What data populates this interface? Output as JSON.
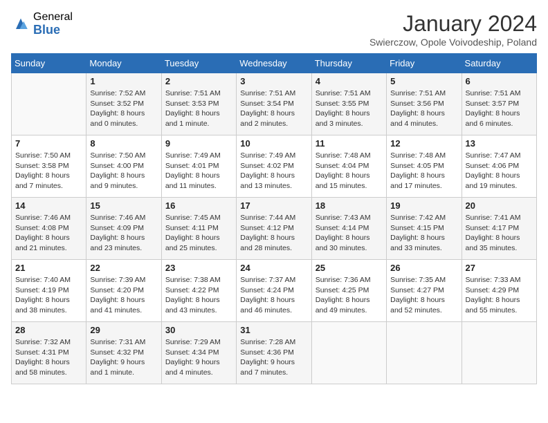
{
  "logo": {
    "general": "General",
    "blue": "Blue"
  },
  "title": {
    "month_year": "January 2024",
    "location": "Swierczow, Opole Voivodeship, Poland"
  },
  "days_of_week": [
    "Sunday",
    "Monday",
    "Tuesday",
    "Wednesday",
    "Thursday",
    "Friday",
    "Saturday"
  ],
  "weeks": [
    [
      {
        "day": "",
        "info": ""
      },
      {
        "day": "1",
        "info": "Sunrise: 7:52 AM\nSunset: 3:52 PM\nDaylight: 8 hours\nand 0 minutes."
      },
      {
        "day": "2",
        "info": "Sunrise: 7:51 AM\nSunset: 3:53 PM\nDaylight: 8 hours\nand 1 minute."
      },
      {
        "day": "3",
        "info": "Sunrise: 7:51 AM\nSunset: 3:54 PM\nDaylight: 8 hours\nand 2 minutes."
      },
      {
        "day": "4",
        "info": "Sunrise: 7:51 AM\nSunset: 3:55 PM\nDaylight: 8 hours\nand 3 minutes."
      },
      {
        "day": "5",
        "info": "Sunrise: 7:51 AM\nSunset: 3:56 PM\nDaylight: 8 hours\nand 4 minutes."
      },
      {
        "day": "6",
        "info": "Sunrise: 7:51 AM\nSunset: 3:57 PM\nDaylight: 8 hours\nand 6 minutes."
      }
    ],
    [
      {
        "day": "7",
        "info": "Sunrise: 7:50 AM\nSunset: 3:58 PM\nDaylight: 8 hours\nand 7 minutes."
      },
      {
        "day": "8",
        "info": "Sunrise: 7:50 AM\nSunset: 4:00 PM\nDaylight: 8 hours\nand 9 minutes."
      },
      {
        "day": "9",
        "info": "Sunrise: 7:49 AM\nSunset: 4:01 PM\nDaylight: 8 hours\nand 11 minutes."
      },
      {
        "day": "10",
        "info": "Sunrise: 7:49 AM\nSunset: 4:02 PM\nDaylight: 8 hours\nand 13 minutes."
      },
      {
        "day": "11",
        "info": "Sunrise: 7:48 AM\nSunset: 4:04 PM\nDaylight: 8 hours\nand 15 minutes."
      },
      {
        "day": "12",
        "info": "Sunrise: 7:48 AM\nSunset: 4:05 PM\nDaylight: 8 hours\nand 17 minutes."
      },
      {
        "day": "13",
        "info": "Sunrise: 7:47 AM\nSunset: 4:06 PM\nDaylight: 8 hours\nand 19 minutes."
      }
    ],
    [
      {
        "day": "14",
        "info": "Sunrise: 7:46 AM\nSunset: 4:08 PM\nDaylight: 8 hours\nand 21 minutes."
      },
      {
        "day": "15",
        "info": "Sunrise: 7:46 AM\nSunset: 4:09 PM\nDaylight: 8 hours\nand 23 minutes."
      },
      {
        "day": "16",
        "info": "Sunrise: 7:45 AM\nSunset: 4:11 PM\nDaylight: 8 hours\nand 25 minutes."
      },
      {
        "day": "17",
        "info": "Sunrise: 7:44 AM\nSunset: 4:12 PM\nDaylight: 8 hours\nand 28 minutes."
      },
      {
        "day": "18",
        "info": "Sunrise: 7:43 AM\nSunset: 4:14 PM\nDaylight: 8 hours\nand 30 minutes."
      },
      {
        "day": "19",
        "info": "Sunrise: 7:42 AM\nSunset: 4:15 PM\nDaylight: 8 hours\nand 33 minutes."
      },
      {
        "day": "20",
        "info": "Sunrise: 7:41 AM\nSunset: 4:17 PM\nDaylight: 8 hours\nand 35 minutes."
      }
    ],
    [
      {
        "day": "21",
        "info": "Sunrise: 7:40 AM\nSunset: 4:19 PM\nDaylight: 8 hours\nand 38 minutes."
      },
      {
        "day": "22",
        "info": "Sunrise: 7:39 AM\nSunset: 4:20 PM\nDaylight: 8 hours\nand 41 minutes."
      },
      {
        "day": "23",
        "info": "Sunrise: 7:38 AM\nSunset: 4:22 PM\nDaylight: 8 hours\nand 43 minutes."
      },
      {
        "day": "24",
        "info": "Sunrise: 7:37 AM\nSunset: 4:24 PM\nDaylight: 8 hours\nand 46 minutes."
      },
      {
        "day": "25",
        "info": "Sunrise: 7:36 AM\nSunset: 4:25 PM\nDaylight: 8 hours\nand 49 minutes."
      },
      {
        "day": "26",
        "info": "Sunrise: 7:35 AM\nSunset: 4:27 PM\nDaylight: 8 hours\nand 52 minutes."
      },
      {
        "day": "27",
        "info": "Sunrise: 7:33 AM\nSunset: 4:29 PM\nDaylight: 8 hours\nand 55 minutes."
      }
    ],
    [
      {
        "day": "28",
        "info": "Sunrise: 7:32 AM\nSunset: 4:31 PM\nDaylight: 8 hours\nand 58 minutes."
      },
      {
        "day": "29",
        "info": "Sunrise: 7:31 AM\nSunset: 4:32 PM\nDaylight: 9 hours\nand 1 minute."
      },
      {
        "day": "30",
        "info": "Sunrise: 7:29 AM\nSunset: 4:34 PM\nDaylight: 9 hours\nand 4 minutes."
      },
      {
        "day": "31",
        "info": "Sunrise: 7:28 AM\nSunset: 4:36 PM\nDaylight: 9 hours\nand 7 minutes."
      },
      {
        "day": "",
        "info": ""
      },
      {
        "day": "",
        "info": ""
      },
      {
        "day": "",
        "info": ""
      }
    ]
  ]
}
